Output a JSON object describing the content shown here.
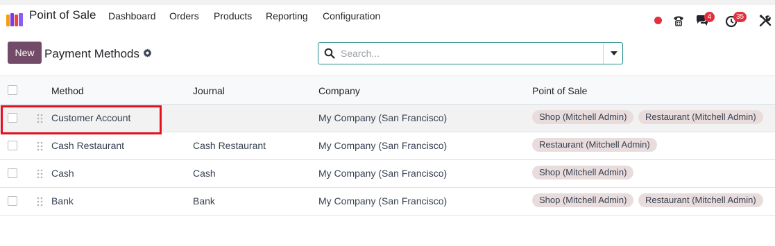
{
  "app": {
    "name": "Point of Sale"
  },
  "nav": {
    "menus": [
      "Dashboard",
      "Orders",
      "Products",
      "Reporting",
      "Configuration"
    ]
  },
  "systray": {
    "recording": "recording-dot",
    "phone": "phone-icon",
    "messages": {
      "icon": "chat-icon",
      "count": "4"
    },
    "activities": {
      "icon": "clock-icon",
      "count": "35"
    },
    "debug": "tools-icon"
  },
  "control": {
    "new_label": "New",
    "title": "Payment Methods",
    "search_placeholder": "Search..."
  },
  "table": {
    "headers": [
      "Method",
      "Journal",
      "Company",
      "Point of Sale"
    ],
    "rows": [
      {
        "method": "Customer Account",
        "journal": "",
        "company": "My Company (San Francisco)",
        "pos": [
          "Shop (Mitchell Admin)",
          "Restaurant (Mitchell Admin)"
        ]
      },
      {
        "method": "Cash Restaurant",
        "journal": "Cash Restaurant",
        "company": "My Company (San Francisco)",
        "pos": [
          "Restaurant (Mitchell Admin)"
        ]
      },
      {
        "method": "Cash",
        "journal": "Cash",
        "company": "My Company (San Francisco)",
        "pos": [
          "Shop (Mitchell Admin)"
        ]
      },
      {
        "method": "Bank",
        "journal": "Bank",
        "company": "My Company (San Francisco)",
        "pos": [
          "Shop (Mitchell Admin)",
          "Restaurant (Mitchell Admin)"
        ]
      }
    ]
  },
  "colors": {
    "brand": "#714b67",
    "badge": "#e2313d",
    "tag_bg": "#e9dcdc",
    "highlight": "#e3101f"
  }
}
